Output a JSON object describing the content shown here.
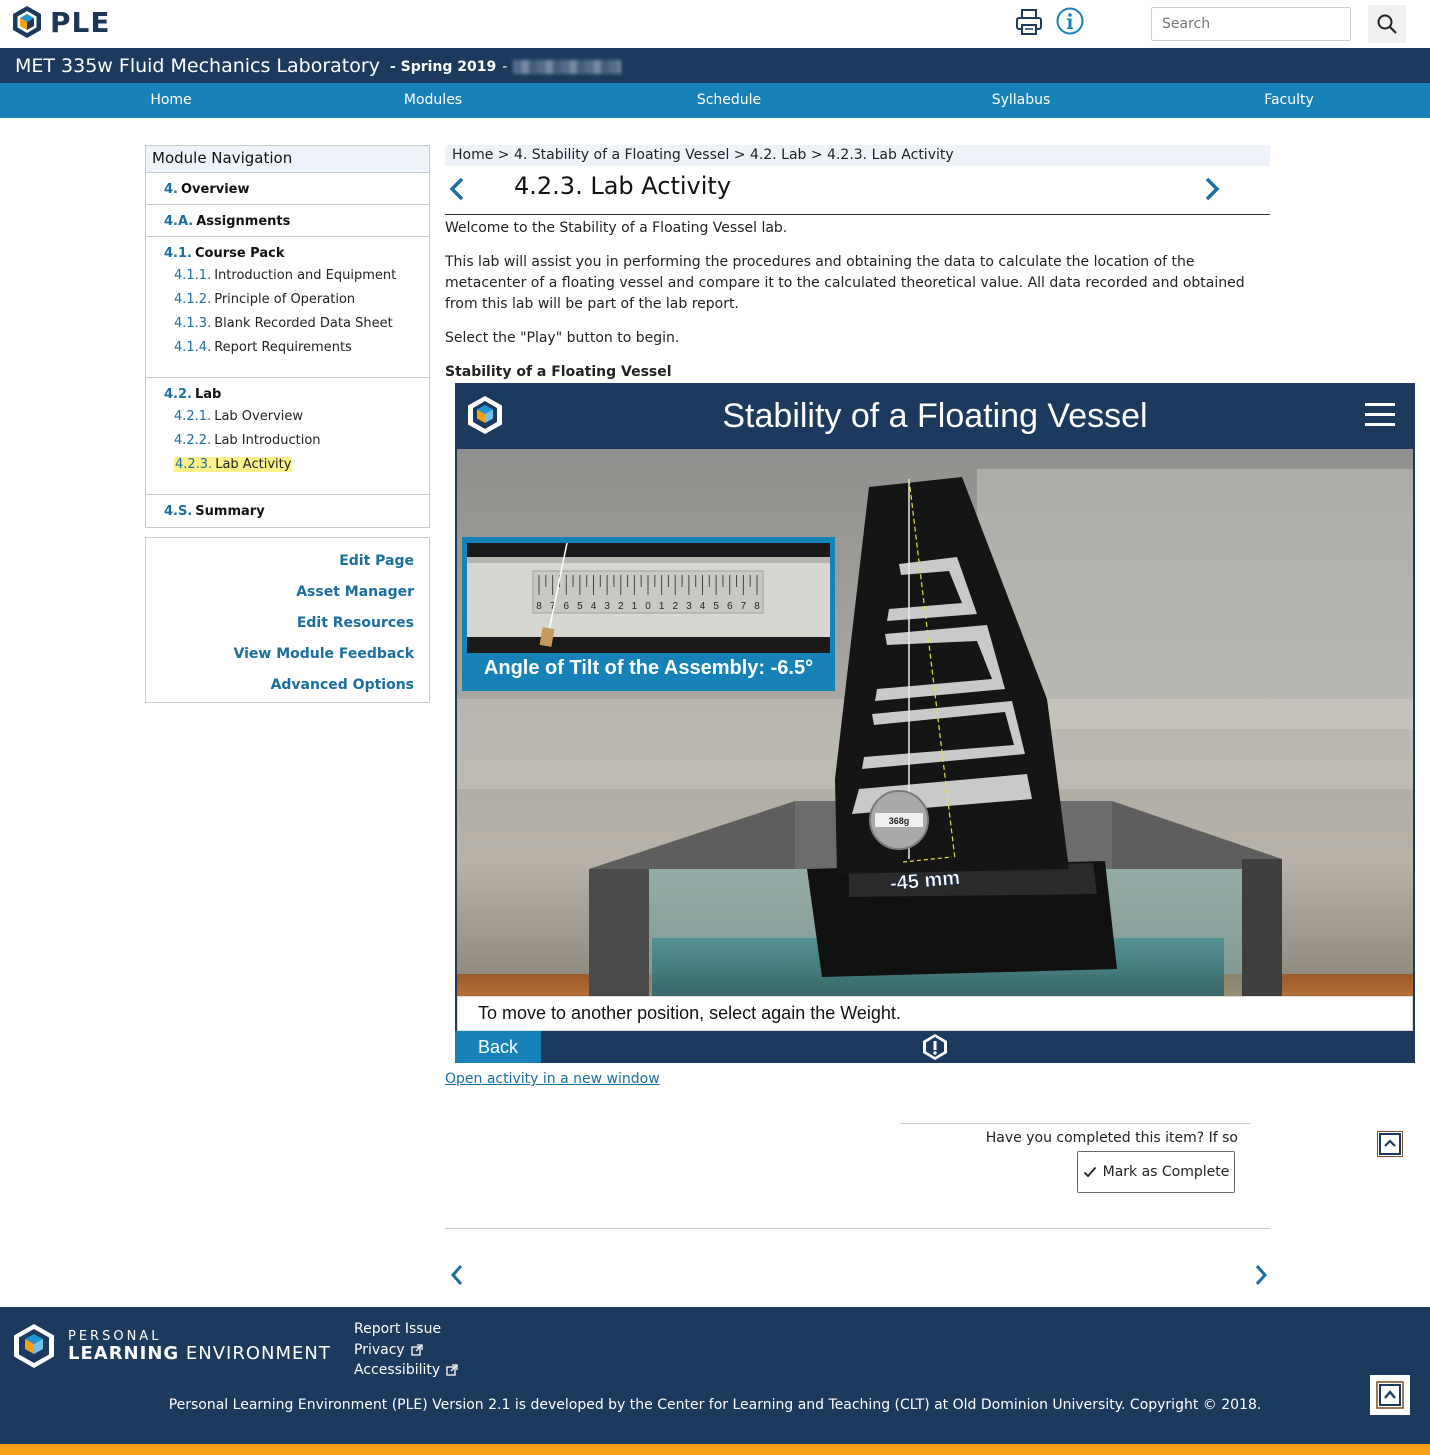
{
  "brand": {
    "logo_text": "PLE"
  },
  "search": {
    "placeholder": "Search"
  },
  "course": {
    "title": "MET 335w Fluid Mechanics Laboratory",
    "term": "- Spring 2019",
    "dash": "-"
  },
  "nav": {
    "items": [
      "Home",
      "Modules",
      "Schedule",
      "Syllabus",
      "Faculty"
    ]
  },
  "module_nav": {
    "title": "Module Navigation",
    "sections": [
      {
        "num": "4.",
        "label": "Overview",
        "items": []
      },
      {
        "num": "4.A.",
        "label": "Assignments",
        "items": []
      },
      {
        "num": "4.1.",
        "label": "Course Pack",
        "items": [
          {
            "num": "4.1.1.",
            "label": "Introduction and Equipment"
          },
          {
            "num": "4.1.2.",
            "label": "Principle of Operation"
          },
          {
            "num": "4.1.3.",
            "label": "Blank Recorded Data Sheet"
          },
          {
            "num": "4.1.4.",
            "label": "Report Requirements"
          }
        ]
      },
      {
        "num": "4.2.",
        "label": "Lab",
        "items": [
          {
            "num": "4.2.1.",
            "label": "Lab Overview"
          },
          {
            "num": "4.2.2.",
            "label": "Lab Introduction"
          },
          {
            "num": "4.2.3.",
            "label": "Lab Activity",
            "active": true
          }
        ]
      },
      {
        "num": "4.S.",
        "label": "Summary",
        "items": []
      }
    ]
  },
  "tools": [
    "Edit Page",
    "Asset Manager",
    "Edit Resources",
    "View Module Feedback",
    "Advanced Options"
  ],
  "breadcrumb": "Home > 4. Stability of a Floating Vessel > 4.2. Lab > 4.2.3. Lab Activity",
  "page": {
    "title": "4.2.3. Lab Activity",
    "welcome": "Welcome to the Stability of a Floating Vessel lab.",
    "intro": "This lab will assist you in performing the procedures and obtaining the data to calculate the location of the metacenter of a floating vessel and compare it to the calculated theoretical value. All data recorded and obtained from this lab will be part of the lab report.",
    "instruction": "Select the \"Play\" button to begin.",
    "activity_heading": "Stability of a Floating Vessel"
  },
  "activity": {
    "title": "Stability of a Floating Vessel",
    "tilt_label": "Angle of Tilt of the Assembly: -6.5°",
    "weight_label": "368g",
    "position_label": "-45 mm",
    "scale_ticks": [
      "8",
      "7",
      "6",
      "5",
      "4",
      "3",
      "2",
      "1",
      "0",
      "1",
      "2",
      "3",
      "4",
      "5",
      "6",
      "7",
      "8"
    ],
    "caption": "To move to another position, select again the Weight.",
    "back_label": "Back"
  },
  "open_link": "Open activity in a new window",
  "completion": {
    "question": "Have you completed this item? If so",
    "button_label": "Mark as Complete"
  },
  "footer": {
    "brand_line1": "PERSONAL",
    "brand_line2a": "LEARNING",
    "brand_line2b": "ENVIRONMENT",
    "links": [
      "Report Issue",
      "Privacy",
      "Accessibility"
    ],
    "copyright": "Personal Learning Environment (PLE) Version 2.1 is developed by the Center for Learning and Teaching (CLT) at Old Dominion University. Copyright © 2018."
  },
  "colors": {
    "navy": "#1c3a5e",
    "blue": "#1782b7",
    "link": "#1a6fa0",
    "highlight": "#fbf28a",
    "orange": "#f6a01a"
  }
}
